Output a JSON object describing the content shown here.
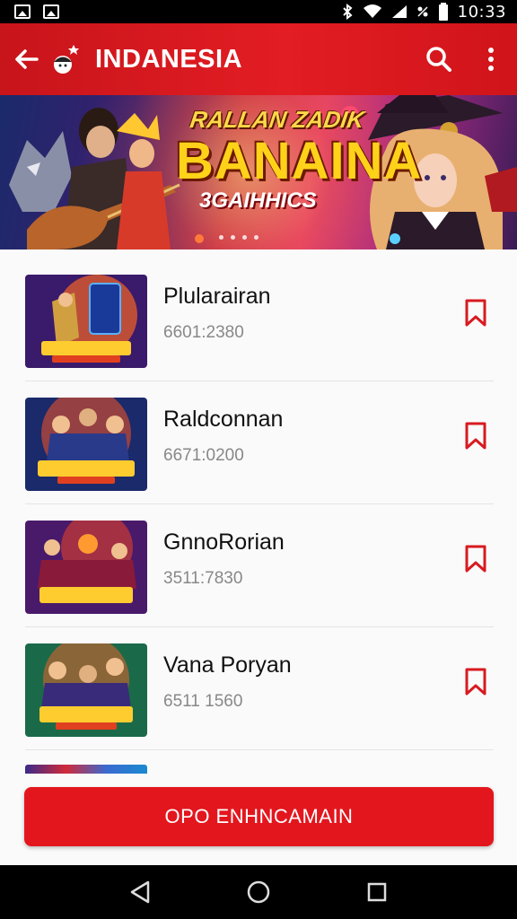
{
  "status_bar": {
    "time": "10:33"
  },
  "header": {
    "title": "INDANESIA",
    "back_icon": "back-arrow-icon",
    "search_icon": "search-icon",
    "menu_icon": "more-vert-icon",
    "accent": "#e21d23"
  },
  "banner": {
    "line1": "RALLAN ZADIK",
    "line2": "BANAINA",
    "line3": "3GAIHHICS"
  },
  "items": [
    {
      "title": "Plularairan",
      "meta": "6601:2380"
    },
    {
      "title": "Raldconnan",
      "meta": "6671:0200"
    },
    {
      "title": "GnnoRorian",
      "meta": "3511:7830"
    },
    {
      "title": "Vana Poryan",
      "meta": "6511 1560"
    }
  ],
  "cta": {
    "label": "OPO ENHNCAMAIN"
  },
  "colors": {
    "brand_red": "#e3161e",
    "header_red": "#d0141a"
  }
}
